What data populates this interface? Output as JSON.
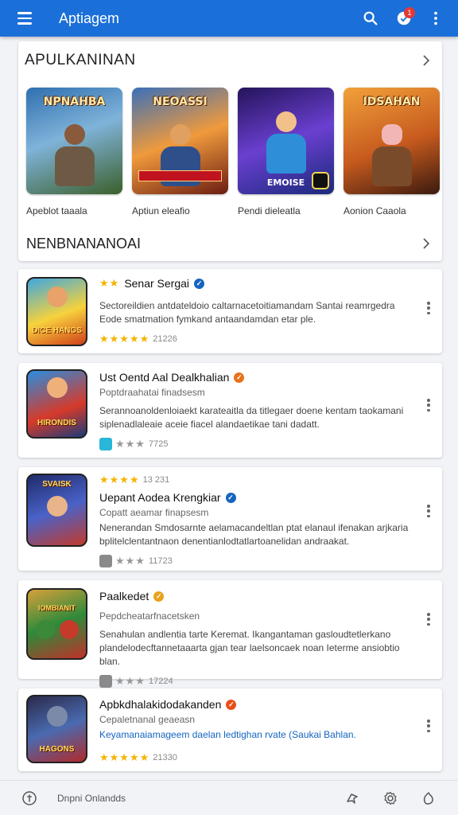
{
  "appbar": {
    "title": "Aptiagem",
    "notification_count": "1"
  },
  "featured": {
    "title": "APULKANINAN",
    "tiles": [
      {
        "caption": "Apeblot taaala",
        "art": "NPNAHBA"
      },
      {
        "caption": "Aptiun eleafio",
        "art": "NEOASSI"
      },
      {
        "caption": "Pendi dieleatla",
        "art": "EMOISE"
      },
      {
        "caption": "Aonion Caaola",
        "art": "IDSAHAN"
      }
    ],
    "section2_title": "NENBNANANOAI"
  },
  "apps": [
    {
      "title": "Senar Sergai",
      "prefix_stars": "★★",
      "subtitle": "",
      "description": "Sectoreildien antdateldoio caltarnacetoitiamandam Santai reamrgedra Eode smatmation fymkand antaandamdan etar ple.",
      "rating_text": "21226",
      "art": "DICE HANGS"
    },
    {
      "title": "Ust Oentd Aal Dealkhalian",
      "prefix_stars": "",
      "subtitle": "Poptdraahatai finadsesm",
      "description": "Serannoanoldenloiaekt karateaitla da titlegaer doene kentam taokamani siplenadlaleaie aceie fiacel alandaetikae tani dadatt.",
      "rating_text": "7725",
      "art": "HIRONDIS"
    },
    {
      "title": "Uepant Aodea Krengkiar",
      "prefix_stars": "★★★★",
      "prefix_text": "13 231",
      "subtitle": "Copatt aeamar finapsesm",
      "description": "Nenerandan Smdosarnte aelamacandeltlan ptat elanaul ifenakan arjkaria bplitelclentantnaon denentianlodtatlartoanelidan andraakat.",
      "rating_text": "11723",
      "art": "SVAISK"
    },
    {
      "title": "Paalkedet",
      "prefix_stars": "",
      "subtitle": "Pepdcheatarfnacetsken",
      "description": "Senahulan andlentia tarte Keremat. Ikangantaman gasloudtetlerkano plandelodecftannetaaarta gjan tear laelsoncaek noan Ieterme ansiobtio blan.",
      "rating_text": "17224",
      "art": "IOMBIANIT"
    },
    {
      "title": "Apbkdhalakidodakanden",
      "prefix_stars": "",
      "subtitle": "Cepaletnanal geaeasn",
      "description": "Keyamanaiamageem daelan ledtighan rvate (Saukai Bahlan.",
      "rating_text": "21330",
      "art": "HAGONS"
    }
  ],
  "bottom": {
    "label": "Dnpni Onlandds"
  },
  "colors": {
    "primary": "#1b6fd8",
    "star": "#f5b301",
    "verified_blue": "#1565c0",
    "verified_orange": "#e8711a"
  }
}
